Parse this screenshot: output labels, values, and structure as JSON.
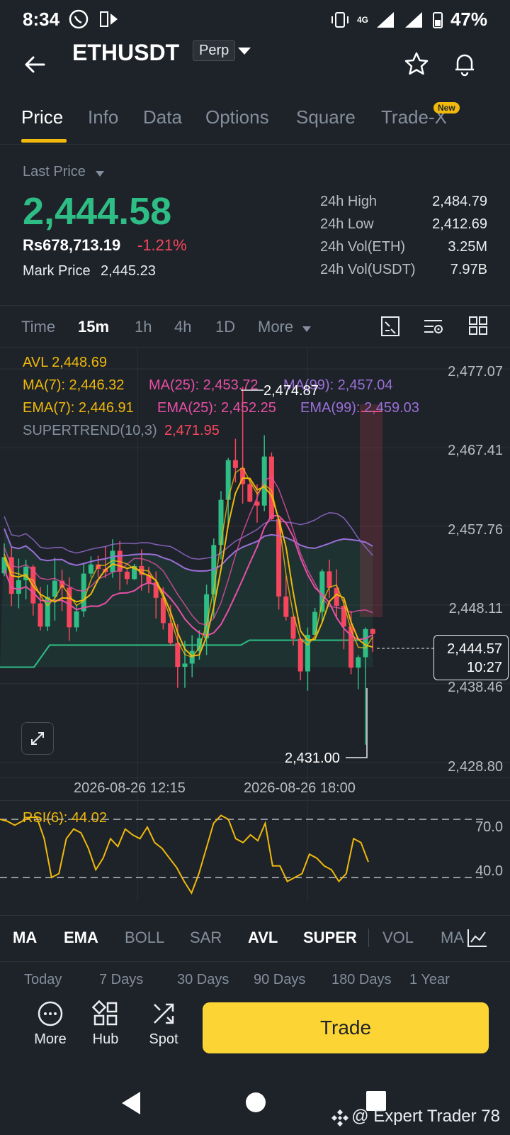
{
  "status_bar": {
    "time": "8:34",
    "network": "4G",
    "battery": "47%"
  },
  "header": {
    "pair": "ETHUSDT",
    "badge": "Perp"
  },
  "tabs": [
    {
      "label": "Price"
    },
    {
      "label": "Info"
    },
    {
      "label": "Data"
    },
    {
      "label": "Options"
    },
    {
      "label": "Square"
    },
    {
      "label": "Trade-X"
    }
  ],
  "new_badge": "New",
  "price_section": {
    "last_price_label": "Last Price",
    "last_price": "2,444.58",
    "fiat_price": "Rs678,713.19",
    "change": "-1.21%",
    "mark_price_label": "Mark Price",
    "mark_price": "2,445.23",
    "stats": [
      {
        "label": "24h High",
        "value": "2,484.79"
      },
      {
        "label": "24h Low",
        "value": "2,412.69"
      },
      {
        "label": "24h Vol(ETH)",
        "value": "3.25M"
      },
      {
        "label": "24h Vol(USDT)",
        "value": "7.97B"
      }
    ]
  },
  "intervals": {
    "items": [
      {
        "label": "Time"
      },
      {
        "label": "15m"
      },
      {
        "label": "1h"
      },
      {
        "label": "4h"
      },
      {
        "label": "1D"
      },
      {
        "label": "More"
      }
    ]
  },
  "indicators": {
    "avl": "AVL 2,448.69",
    "ma7": "MA(7): 2,446.32",
    "ma25": "MA(25): 2,453.72",
    "ma99": "MA(99): 2,457.04",
    "ema7": "EMA(7): 2,446.91",
    "ema25": "EMA(25): 2,452.25",
    "ema99": "EMA(99): 2,459.03",
    "supertrend_label": "SUPERTREND(10,3)",
    "supertrend_value": "2,471.95"
  },
  "chart_data": {
    "type": "candlestick",
    "y_ticks": [
      "2,477.07",
      "2,467.41",
      "2,457.76",
      "2,448.11",
      "2,438.46",
      "2,428.80"
    ],
    "x_ticks": [
      "2026-08-26 12:15",
      "2026-08-26 18:00"
    ],
    "ylim": [
      2428.8,
      2477.07
    ],
    "high_marker": "2,474.87",
    "low_marker": "2,431.00",
    "current_price": "2,444.57",
    "countdown": "10:27",
    "colors": {
      "up": "#2ebd85",
      "down": "#f6465d",
      "ma7": "#f0b90b",
      "ma25": "#e84fa6",
      "ma99": "#9b6fd8",
      "supertrend": "#2ebd85"
    }
  },
  "rsi": {
    "label": "RSI(6): 44.02",
    "ticks": [
      "70.0",
      "40.0"
    ]
  },
  "indicator_tabs": [
    {
      "label": "MA",
      "active": true
    },
    {
      "label": "EMA",
      "active": true
    },
    {
      "label": "BOLL",
      "active": false
    },
    {
      "label": "SAR",
      "active": false
    },
    {
      "label": "AVL",
      "active": true
    },
    {
      "label": "SUPER",
      "active": true
    },
    {
      "label": "VOL",
      "active": false
    },
    {
      "label": "MA",
      "active": false
    }
  ],
  "periods": [
    {
      "label": "Today"
    },
    {
      "label": "7 Days"
    },
    {
      "label": "30 Days"
    },
    {
      "label": "90 Days"
    },
    {
      "label": "180 Days"
    },
    {
      "label": "1 Year"
    }
  ],
  "bottom_bar": {
    "more": "More",
    "hub": "Hub",
    "spot": "Spot",
    "trade": "Trade"
  },
  "watermark": "@ Expert Trader 78"
}
